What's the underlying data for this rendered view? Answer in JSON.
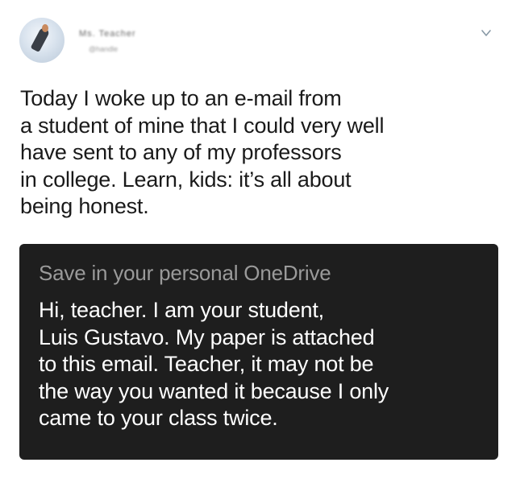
{
  "tweet": {
    "author_name": "Ms. Teacher",
    "author_handle": "@handle",
    "text": "Today I woke up to an e-mail from\na student of mine that I could very well\nhave sent to any of my professors\nin college. Learn, kids: it’s all about\nbeing honest."
  },
  "media": {
    "caption": "Save in your personal OneDrive",
    "message": "Hi, teacher. I am your student,\nLuis Gustavo. My paper is attached\nto this email. Teacher, it may not be\nthe way you wanted it because I only\ncame to your class twice."
  },
  "icons": {
    "menu": "chevron-down-icon",
    "avatar": "avatar"
  }
}
